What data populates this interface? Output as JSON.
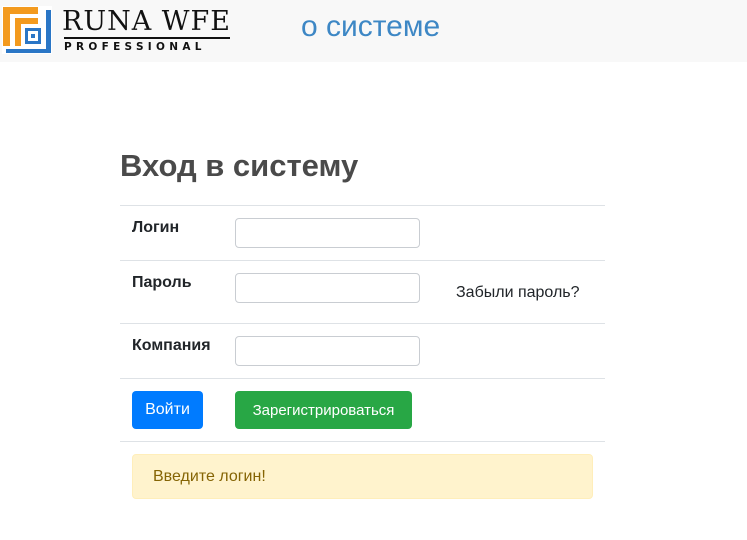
{
  "header": {
    "logo": {
      "word": "RUNA WFE",
      "sub": "PROFESSIONAL",
      "colors": {
        "orange": "#f39a1e",
        "blue": "#2a76c6"
      }
    },
    "about_link": "о системе",
    "link_color": "#3d87c5",
    "background": "#f8f8f8"
  },
  "login": {
    "title": "Вход в систему",
    "fields": {
      "login": {
        "label": "Логин",
        "value": "",
        "placeholder": ""
      },
      "password": {
        "label": "Пароль",
        "value": "",
        "placeholder": ""
      },
      "company": {
        "label": "Компания",
        "value": "",
        "placeholder": ""
      }
    },
    "forgot_password": "Забыли пароль?",
    "buttons": {
      "login": "Войти",
      "register": "Зарегистрироваться"
    },
    "alert": "Введите логин!",
    "colors": {
      "primary": "#007bff",
      "success": "#28a745",
      "warning_bg": "#fff3cd",
      "warning_text": "#856404"
    }
  }
}
